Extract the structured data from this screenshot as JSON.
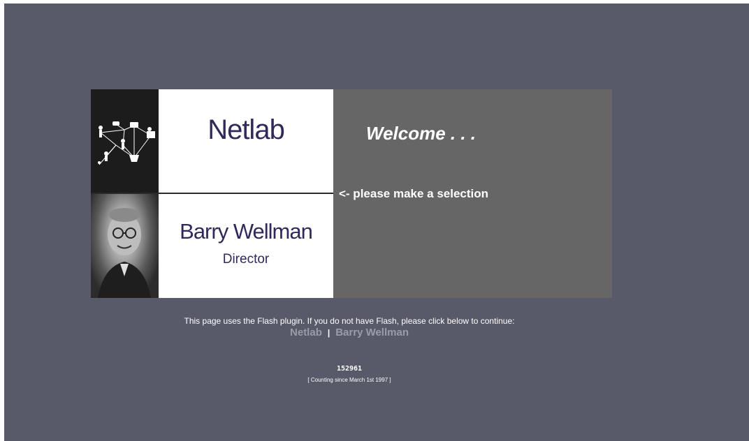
{
  "banner": {
    "netlab_title": "Netlab",
    "person_name": "Barry Wellman",
    "person_role": "Director",
    "welcome": "Welcome . . .",
    "selection_hint": "<- please make a selection"
  },
  "footer": {
    "flash_note": "This page uses the Flash plugin. If you do not have Flash, please click below to continue:",
    "link_netlab": "Netlab",
    "link_separator": "|",
    "link_barry": "Barry Wellman",
    "counter": "152961",
    "counting_since": "[ Counting since March 1st 1997 ]"
  },
  "colors": {
    "page_bg": "#585a6a",
    "panel_grey": "#666666",
    "title_navy": "#2f2a5a",
    "link_grey": "#9a9ca8"
  }
}
